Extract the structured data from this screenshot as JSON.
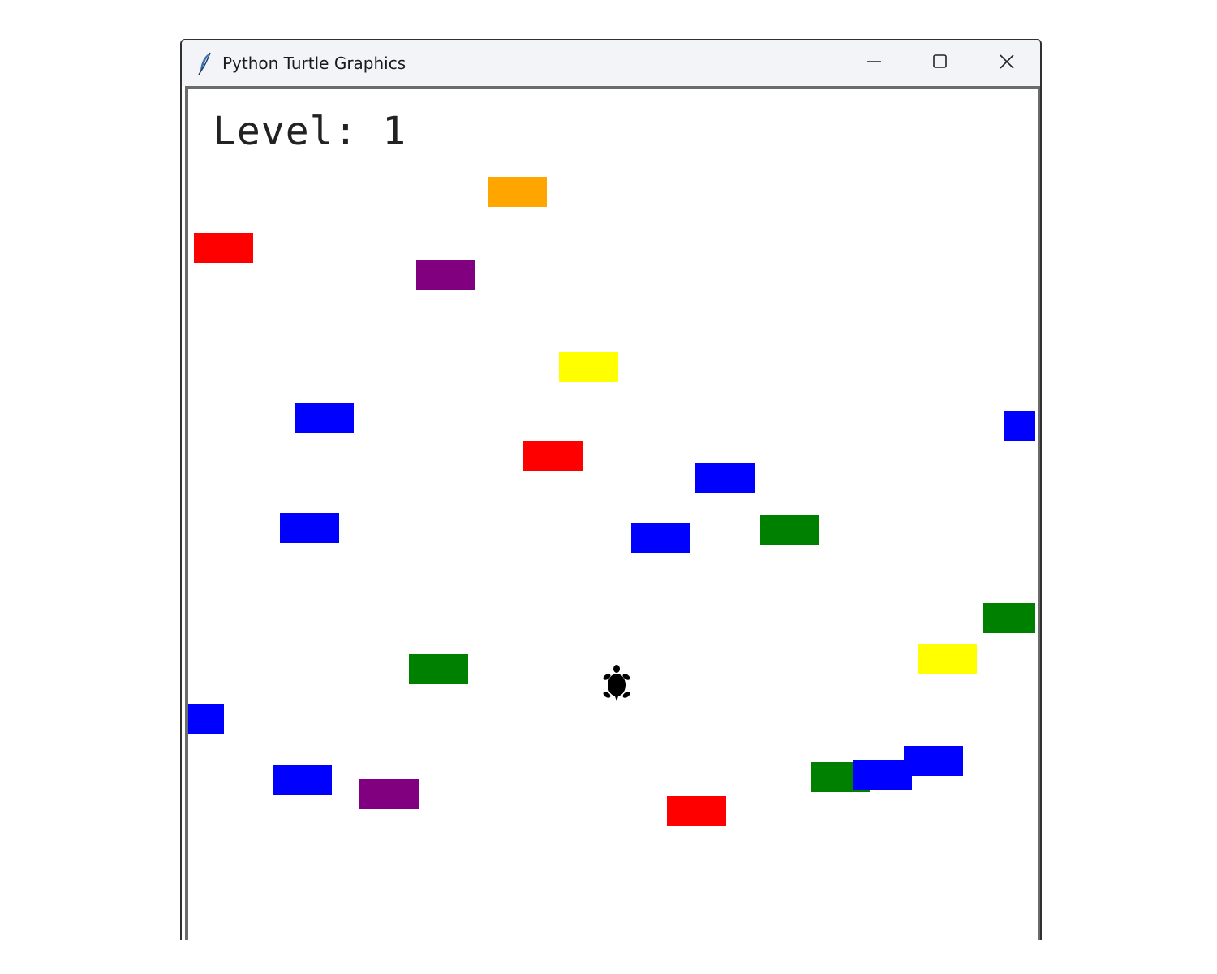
{
  "window": {
    "title": "Python Turtle Graphics",
    "icons": {
      "app": "feather-icon",
      "minimize": "minimize-icon",
      "maximize": "maximize-icon",
      "close": "close-icon"
    }
  },
  "game": {
    "level_label": "Level: 1",
    "player": "turtle-icon",
    "blocks": [
      {
        "color": "#ffa500"
      },
      {
        "color": "#ff0000"
      },
      {
        "color": "#800080"
      },
      {
        "color": "#ffff00"
      },
      {
        "color": "#0000ff"
      },
      {
        "color": "#0000ff"
      },
      {
        "color": "#ff0000"
      },
      {
        "color": "#0000ff"
      },
      {
        "color": "#0000ff"
      },
      {
        "color": "#0000ff"
      },
      {
        "color": "#008000"
      },
      {
        "color": "#008000"
      },
      {
        "color": "#ffff00"
      },
      {
        "color": "#008000"
      },
      {
        "color": "#0000ff"
      },
      {
        "color": "#0000ff"
      },
      {
        "color": "#800080"
      },
      {
        "color": "#008000"
      },
      {
        "color": "#0000ff"
      },
      {
        "color": "#0000ff"
      },
      {
        "color": "#ff0000"
      }
    ]
  }
}
